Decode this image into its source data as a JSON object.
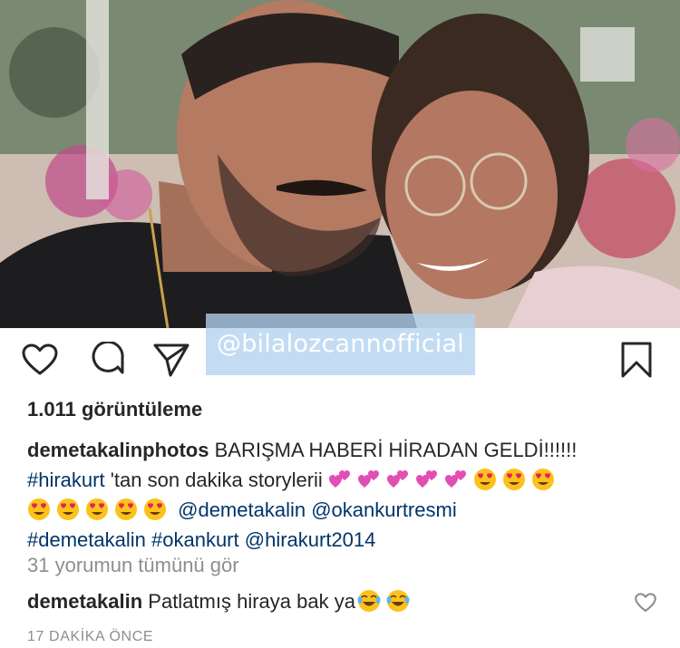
{
  "post": {
    "watermark": "@bilalozcannofficial",
    "views": "1.011 görüntüleme",
    "caption": {
      "username": "demetakalinphotos",
      "line1_text": " BARIŞMA HABERİ HİRADAN GELDİ!!!!!!",
      "hashtag1": "#hirakurt",
      "line2_text": " 'tan son dakika storylerii",
      "mention1": "@demetakalin",
      "mention2": "@okankurtresmi",
      "hashtag2": "#demetakalin",
      "hashtag3": "#okankurt",
      "mention3": "@hirakurt2014"
    },
    "view_comments": "31 yorumun tümünü gör",
    "comment": {
      "username": "demetakalin",
      "text": " Patlatmış hiraya bak ya"
    },
    "timestamp": "17 DAKİKA ÖNCE"
  },
  "icons": {
    "like": "heart-icon",
    "comment": "comment-icon",
    "share": "share-icon",
    "save": "bookmark-icon",
    "comment_like": "heart-outline-icon",
    "emoji_heart": "two-hearts-emoji",
    "emoji_love": "heart-eyes-emoji",
    "emoji_laugh": "tears-of-joy-emoji"
  },
  "colors": {
    "text": "#262626",
    "link": "#003569",
    "secondary": "#8e8e8e",
    "watermark_bg": "#b2d2f0"
  }
}
